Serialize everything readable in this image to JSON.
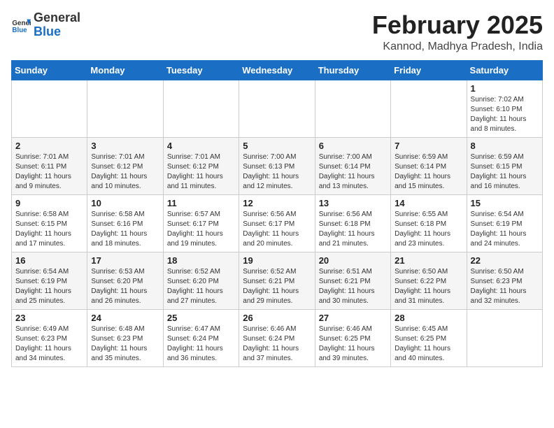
{
  "header": {
    "logo_general": "General",
    "logo_blue": "Blue",
    "month_year": "February 2025",
    "location": "Kannod, Madhya Pradesh, India"
  },
  "days_of_week": [
    "Sunday",
    "Monday",
    "Tuesday",
    "Wednesday",
    "Thursday",
    "Friday",
    "Saturday"
  ],
  "weeks": [
    [
      {
        "day": "",
        "info": ""
      },
      {
        "day": "",
        "info": ""
      },
      {
        "day": "",
        "info": ""
      },
      {
        "day": "",
        "info": ""
      },
      {
        "day": "",
        "info": ""
      },
      {
        "day": "",
        "info": ""
      },
      {
        "day": "1",
        "info": "Sunrise: 7:02 AM\nSunset: 6:10 PM\nDaylight: 11 hours\nand 8 minutes."
      }
    ],
    [
      {
        "day": "2",
        "info": "Sunrise: 7:01 AM\nSunset: 6:11 PM\nDaylight: 11 hours\nand 9 minutes."
      },
      {
        "day": "3",
        "info": "Sunrise: 7:01 AM\nSunset: 6:12 PM\nDaylight: 11 hours\nand 10 minutes."
      },
      {
        "day": "4",
        "info": "Sunrise: 7:01 AM\nSunset: 6:12 PM\nDaylight: 11 hours\nand 11 minutes."
      },
      {
        "day": "5",
        "info": "Sunrise: 7:00 AM\nSunset: 6:13 PM\nDaylight: 11 hours\nand 12 minutes."
      },
      {
        "day": "6",
        "info": "Sunrise: 7:00 AM\nSunset: 6:14 PM\nDaylight: 11 hours\nand 13 minutes."
      },
      {
        "day": "7",
        "info": "Sunrise: 6:59 AM\nSunset: 6:14 PM\nDaylight: 11 hours\nand 15 minutes."
      },
      {
        "day": "8",
        "info": "Sunrise: 6:59 AM\nSunset: 6:15 PM\nDaylight: 11 hours\nand 16 minutes."
      }
    ],
    [
      {
        "day": "9",
        "info": "Sunrise: 6:58 AM\nSunset: 6:15 PM\nDaylight: 11 hours\nand 17 minutes."
      },
      {
        "day": "10",
        "info": "Sunrise: 6:58 AM\nSunset: 6:16 PM\nDaylight: 11 hours\nand 18 minutes."
      },
      {
        "day": "11",
        "info": "Sunrise: 6:57 AM\nSunset: 6:17 PM\nDaylight: 11 hours\nand 19 minutes."
      },
      {
        "day": "12",
        "info": "Sunrise: 6:56 AM\nSunset: 6:17 PM\nDaylight: 11 hours\nand 20 minutes."
      },
      {
        "day": "13",
        "info": "Sunrise: 6:56 AM\nSunset: 6:18 PM\nDaylight: 11 hours\nand 21 minutes."
      },
      {
        "day": "14",
        "info": "Sunrise: 6:55 AM\nSunset: 6:18 PM\nDaylight: 11 hours\nand 23 minutes."
      },
      {
        "day": "15",
        "info": "Sunrise: 6:54 AM\nSunset: 6:19 PM\nDaylight: 11 hours\nand 24 minutes."
      }
    ],
    [
      {
        "day": "16",
        "info": "Sunrise: 6:54 AM\nSunset: 6:19 PM\nDaylight: 11 hours\nand 25 minutes."
      },
      {
        "day": "17",
        "info": "Sunrise: 6:53 AM\nSunset: 6:20 PM\nDaylight: 11 hours\nand 26 minutes."
      },
      {
        "day": "18",
        "info": "Sunrise: 6:52 AM\nSunset: 6:20 PM\nDaylight: 11 hours\nand 27 minutes."
      },
      {
        "day": "19",
        "info": "Sunrise: 6:52 AM\nSunset: 6:21 PM\nDaylight: 11 hours\nand 29 minutes."
      },
      {
        "day": "20",
        "info": "Sunrise: 6:51 AM\nSunset: 6:21 PM\nDaylight: 11 hours\nand 30 minutes."
      },
      {
        "day": "21",
        "info": "Sunrise: 6:50 AM\nSunset: 6:22 PM\nDaylight: 11 hours\nand 31 minutes."
      },
      {
        "day": "22",
        "info": "Sunrise: 6:50 AM\nSunset: 6:23 PM\nDaylight: 11 hours\nand 32 minutes."
      }
    ],
    [
      {
        "day": "23",
        "info": "Sunrise: 6:49 AM\nSunset: 6:23 PM\nDaylight: 11 hours\nand 34 minutes."
      },
      {
        "day": "24",
        "info": "Sunrise: 6:48 AM\nSunset: 6:23 PM\nDaylight: 11 hours\nand 35 minutes."
      },
      {
        "day": "25",
        "info": "Sunrise: 6:47 AM\nSunset: 6:24 PM\nDaylight: 11 hours\nand 36 minutes."
      },
      {
        "day": "26",
        "info": "Sunrise: 6:46 AM\nSunset: 6:24 PM\nDaylight: 11 hours\nand 37 minutes."
      },
      {
        "day": "27",
        "info": "Sunrise: 6:46 AM\nSunset: 6:25 PM\nDaylight: 11 hours\nand 39 minutes."
      },
      {
        "day": "28",
        "info": "Sunrise: 6:45 AM\nSunset: 6:25 PM\nDaylight: 11 hours\nand 40 minutes."
      },
      {
        "day": "",
        "info": ""
      }
    ]
  ]
}
